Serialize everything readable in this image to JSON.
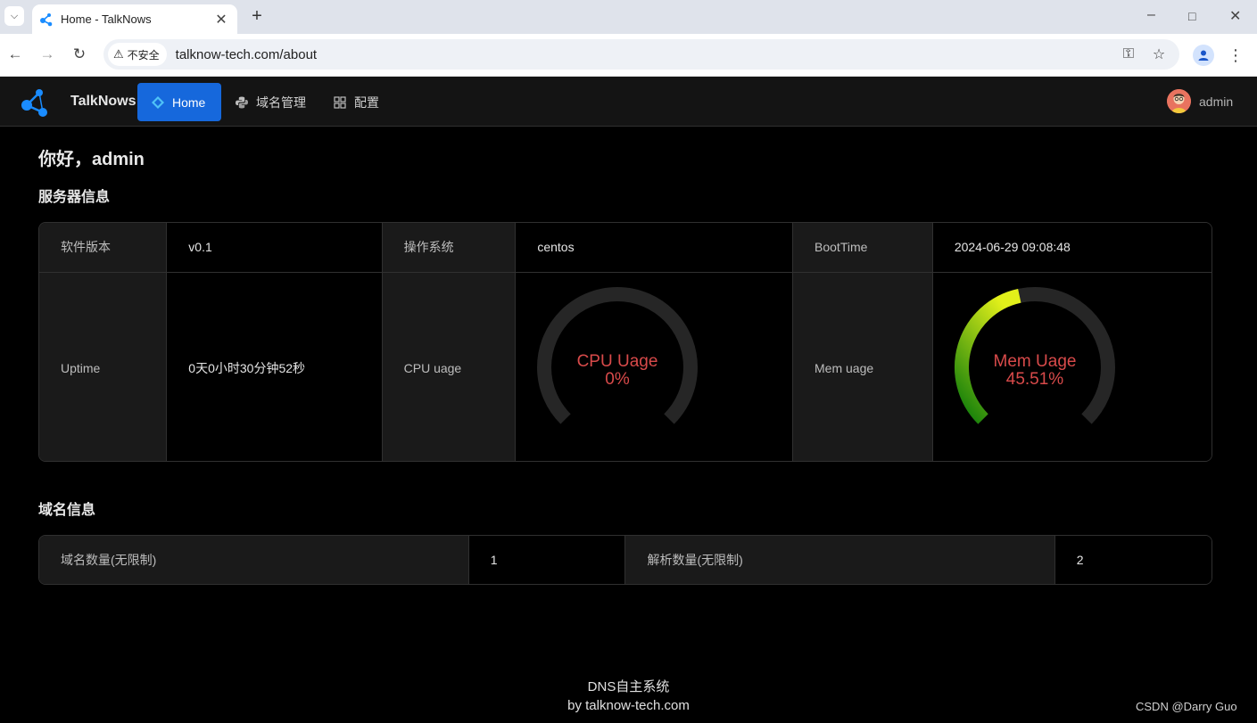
{
  "browser": {
    "tab_title": "Home - TalkNows",
    "security_label": "不安全",
    "url": "talknow-tech.com/about"
  },
  "app": {
    "brand": "TalkNows",
    "menu": [
      {
        "label": "Home",
        "icon": "diamond-icon",
        "active": true
      },
      {
        "label": "域名管理",
        "icon": "python-icon",
        "active": false
      },
      {
        "label": "配置",
        "icon": "grid-icon",
        "active": false
      }
    ],
    "user": "admin"
  },
  "greeting": "你好，admin",
  "server": {
    "title": "服务器信息",
    "software_version_label": "软件版本",
    "software_version": "v0.1",
    "os_label": "操作系统",
    "os": "centos",
    "boottime_label": "BootTime",
    "boottime": "2024-06-29 09:08:48",
    "uptime_label": "Uptime",
    "uptime": "0天0小时30分钟52秒",
    "cpu_label": "CPU uage",
    "cpu_gauge_title": "CPU Uage",
    "cpu_gauge_value": "0%",
    "cpu_percent": 0,
    "mem_label": "Mem uage",
    "mem_gauge_title": "Mem Uage",
    "mem_gauge_value": "45.51%",
    "mem_percent": 45.51
  },
  "domain": {
    "title": "域名信息",
    "domain_count_label": "域名数量(无限制)",
    "domain_count": "1",
    "record_count_label": "解析数量(无限制)",
    "record_count": "2"
  },
  "footer": {
    "line1": "DNS自主系统",
    "line2": "by talknow-tech.com"
  },
  "watermark": "CSDN @Darry Guo",
  "colors": {
    "accent": "#1668dc",
    "gauge_text": "#d84a4a",
    "gauge_track": "#262626",
    "gauge_start": "#0a7a0a",
    "gauge_end": "#e2f01a"
  }
}
